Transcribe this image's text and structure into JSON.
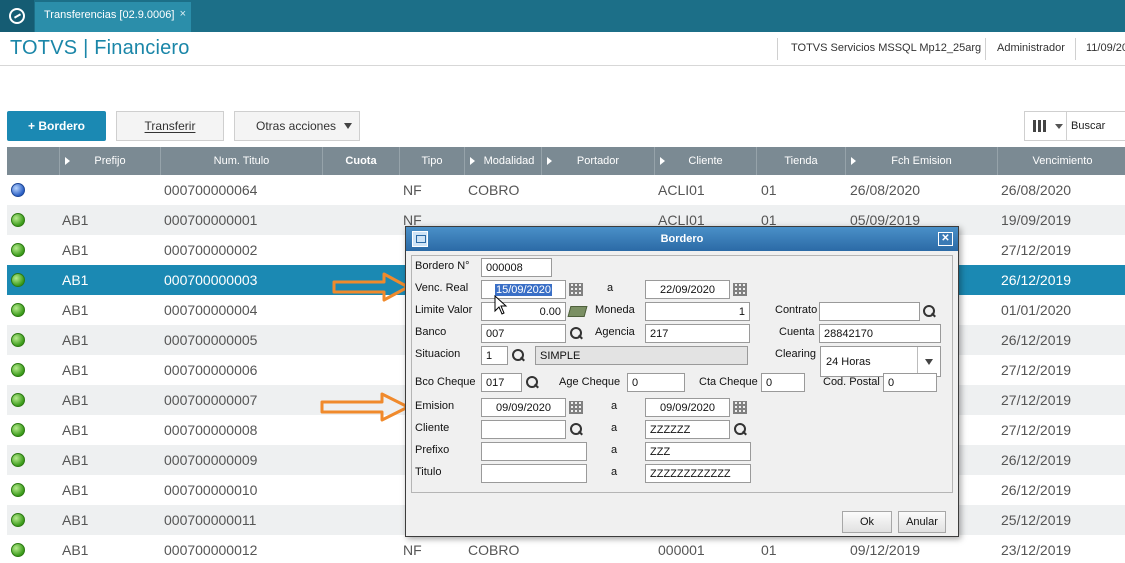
{
  "tab": {
    "label": "Transferencias [02.9.0006]",
    "close": "×"
  },
  "header": {
    "title": "TOTVS | Financiero",
    "server": "TOTVS Servicios MSSQL Mp12_25arg",
    "user": "Administrador",
    "date": "11/09/20"
  },
  "toolbar": {
    "primary": "+ Bordero",
    "transfer": "Transferir",
    "more": "Otras acciones",
    "search_label": "Buscar"
  },
  "colors": {
    "accent": "#1b89b3",
    "header_bg": "#1c6f88",
    "grid_head": "#7b8a93",
    "arrow": "#f08a2c"
  },
  "grid": {
    "columns": [
      "",
      "Prefijo",
      "Num. Titulo",
      "Cuota",
      "Tipo",
      "Modalidad",
      "Portador",
      "Cliente",
      "Tienda",
      "Fch Emision",
      "Vencimiento"
    ],
    "rows": [
      {
        "status": "blue",
        "prefijo": "",
        "num": "000700000064",
        "tipo": "NF",
        "modalidad": "COBRO",
        "cliente": "ACLI01",
        "tienda": "01",
        "emision": "26/08/2020",
        "venc": "26/08/2020"
      },
      {
        "status": "green",
        "prefijo": "AB1",
        "num": "000700000001",
        "tipo": "NF",
        "modalidad": "",
        "cliente": "ACLI01",
        "tienda": "01",
        "emision": "05/09/2019",
        "venc": "19/09/2019"
      },
      {
        "status": "green",
        "prefijo": "AB1",
        "num": "000700000002",
        "tipo": "",
        "modalidad": "",
        "cliente": "",
        "tienda": "",
        "emision": "",
        "venc": "27/12/2019"
      },
      {
        "status": "green",
        "prefijo": "AB1",
        "num": "000700000003",
        "tipo": "",
        "modalidad": "",
        "cliente": "",
        "tienda": "",
        "emision": "",
        "venc": "26/12/2019"
      },
      {
        "status": "green",
        "prefijo": "AB1",
        "num": "000700000004",
        "tipo": "",
        "modalidad": "",
        "cliente": "",
        "tienda": "",
        "emision": "",
        "venc": "01/01/2020"
      },
      {
        "status": "green",
        "prefijo": "AB1",
        "num": "000700000005",
        "tipo": "",
        "modalidad": "",
        "cliente": "",
        "tienda": "",
        "emision": "",
        "venc": "26/12/2019"
      },
      {
        "status": "green",
        "prefijo": "AB1",
        "num": "000700000006",
        "tipo": "",
        "modalidad": "",
        "cliente": "",
        "tienda": "",
        "emision": "",
        "venc": "27/12/2019"
      },
      {
        "status": "green",
        "prefijo": "AB1",
        "num": "000700000007",
        "tipo": "",
        "modalidad": "",
        "cliente": "",
        "tienda": "",
        "emision": "",
        "venc": "27/12/2019"
      },
      {
        "status": "green",
        "prefijo": "AB1",
        "num": "000700000008",
        "tipo": "",
        "modalidad": "",
        "cliente": "",
        "tienda": "",
        "emision": "",
        "venc": "27/12/2019"
      },
      {
        "status": "green",
        "prefijo": "AB1",
        "num": "000700000009",
        "tipo": "",
        "modalidad": "",
        "cliente": "",
        "tienda": "",
        "emision": "",
        "venc": "26/12/2019"
      },
      {
        "status": "green",
        "prefijo": "AB1",
        "num": "000700000010",
        "tipo": "",
        "modalidad": "",
        "cliente": "",
        "tienda": "",
        "emision": "",
        "venc": "26/12/2019"
      },
      {
        "status": "green",
        "prefijo": "AB1",
        "num": "000700000011",
        "tipo": "",
        "modalidad": "",
        "cliente": "",
        "tienda": "",
        "emision": "",
        "venc": "25/12/2019"
      },
      {
        "status": "green",
        "prefijo": "AB1",
        "num": "000700000012",
        "tipo": "NF",
        "modalidad": "COBRO",
        "cliente": "000001",
        "tienda": "01",
        "emision": "09/12/2019",
        "venc": "23/12/2019"
      }
    ],
    "selected_index": 3
  },
  "dialog": {
    "title": "Bordero",
    "labels": {
      "bordero_no": "Bordero N°",
      "venc_real": "Venc. Real",
      "a": "a",
      "limite_valor": "Limite Valor",
      "moneda": "Moneda",
      "contrato": "Contrato",
      "banco": "Banco",
      "agencia": "Agencia",
      "cuenta": "Cuenta",
      "situacion": "Situacion",
      "clearing": "Clearing",
      "bco_cheque": "Bco Cheque",
      "age_cheque": "Age Cheque",
      "cta_cheque": "Cta Cheque",
      "cod_postal": "Cod. Postal",
      "emision": "Emision",
      "cliente": "Cliente",
      "prefixo": "Prefixo",
      "titulo": "Titulo"
    },
    "values": {
      "bordero_no": "000008",
      "venc_from": "15/09/2020",
      "venc_to": "22/09/2020",
      "limite_valor": "0.00",
      "moneda": "1",
      "contrato": "",
      "banco": "007",
      "agencia": "217",
      "cuenta": "28842170",
      "situacion_code": "1",
      "situacion_desc": "SIMPLE",
      "clearing": "24 Horas",
      "bco_cheque": "017",
      "age_cheque": "0",
      "cta_cheque": "0",
      "cod_postal": "0",
      "emision_from": "09/09/2020",
      "emision_to": "09/09/2020",
      "cliente_from": "",
      "cliente_to": "ZZZZZZ",
      "prefixo_from": "",
      "prefixo_to": "ZZZ",
      "titulo_from": "",
      "titulo_to": "ZZZZZZZZZZZZ"
    },
    "buttons": {
      "ok": "Ok",
      "cancel": "Anular"
    }
  }
}
